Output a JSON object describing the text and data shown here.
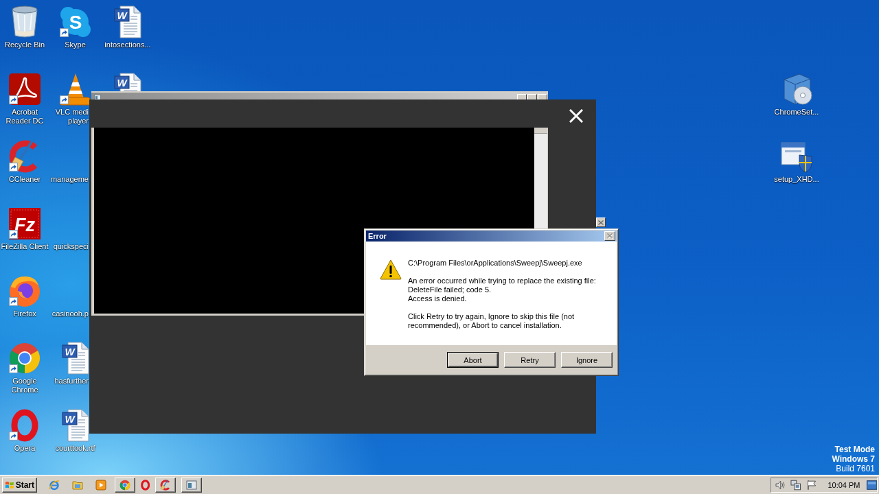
{
  "desktop": {
    "left_icons": [
      {
        "kind": "recycle-bin",
        "label": "Recycle Bin",
        "shortcut": false
      },
      {
        "kind": "pdf",
        "label": "Acrobat\nReader DC",
        "shortcut": true
      },
      {
        "kind": "ccleaner",
        "label": "CCleaner",
        "shortcut": true
      },
      {
        "kind": "filezilla",
        "glyph": "Fz",
        "label": "FileZilla Client",
        "shortcut": true
      },
      {
        "kind": "firefox",
        "label": "Firefox",
        "shortcut": true
      },
      {
        "kind": "chrome",
        "label": "Google\nChrome",
        "shortcut": true
      },
      {
        "kind": "opera",
        "label": "Opera",
        "shortcut": true
      },
      {
        "kind": "skype",
        "glyph": "S",
        "label": "Skype",
        "shortcut": true
      },
      {
        "kind": "vlc",
        "label": "VLC medi\nplayer",
        "shortcut": true
      },
      {
        "kind": "blank",
        "label": "manageme",
        "shortcut": false
      },
      {
        "kind": "blank",
        "label": "quickspeci",
        "shortcut": false
      },
      {
        "kind": "blank",
        "label": "casinooh.p",
        "shortcut": false
      },
      {
        "kind": "word",
        "glyph": "W",
        "label": "hasfurther",
        "shortcut": false
      },
      {
        "kind": "word",
        "glyph": "W",
        "label": "courttook.rtf",
        "shortcut": false
      },
      {
        "kind": "word",
        "glyph": "W",
        "label": "intosections...",
        "shortcut": false
      },
      {
        "kind": "word",
        "glyph": "W",
        "shortcut": false
      }
    ],
    "right_icons": [
      {
        "kind": "software-box",
        "label": "ChromeSet...",
        "shortcut": false
      },
      {
        "kind": "setup",
        "label": "setup_XHD...",
        "shortcut": false
      }
    ]
  },
  "error_dialog": {
    "title": "Error",
    "close_disabled": true,
    "path": "C:\\Program Files\\orApplications\\Sweepj\\Sweepj.exe",
    "message": "An error occurred while trying to replace the existing file:\nDeleteFile failed; code 5.\nAccess is denied.",
    "instruction": "Click Retry to try again, Ignore to skip this file (not recommended), or Abort to cancel installation.",
    "buttons": [
      {
        "label": "Abort",
        "default": true
      },
      {
        "label": "Retry",
        "default": false
      },
      {
        "label": "Ignore",
        "default": false
      }
    ]
  },
  "test_mode_notice": [
    {
      "text": "Test Mode",
      "bold": true
    },
    {
      "text": "Windows 7",
      "bold": true
    },
    {
      "text": "Build 7601",
      "bold": false
    }
  ],
  "taskbar": {
    "start": "Start",
    "quick_launch": [
      {
        "kind": "ie"
      },
      {
        "kind": "folder"
      },
      {
        "kind": "media"
      }
    ],
    "tasks": [
      {
        "kind": "chrome",
        "raised": true
      },
      {
        "kind": "opera",
        "raised": false
      },
      {
        "kind": "ccleaner",
        "raised": true
      },
      {
        "kind": "window",
        "raised": true
      }
    ],
    "tray": [
      {
        "kind": "speaker"
      },
      {
        "kind": "network"
      },
      {
        "kind": "flag"
      }
    ],
    "clock": "10:04 PM"
  }
}
